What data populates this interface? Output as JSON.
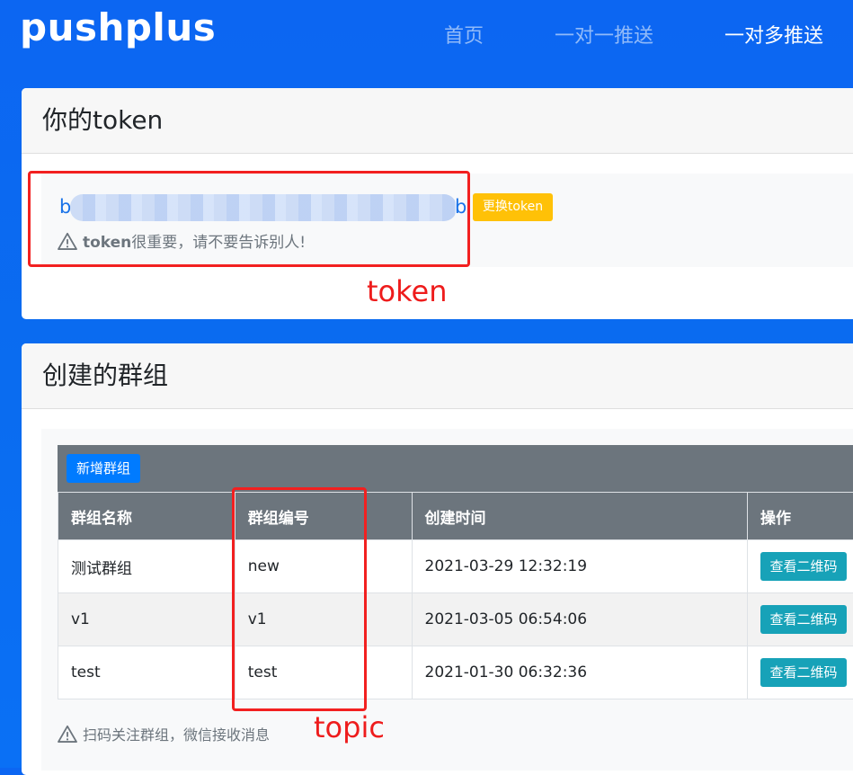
{
  "nav": {
    "brand": "pushplus",
    "links": [
      "首页",
      "一对一推送",
      "一对多推送"
    ]
  },
  "token_card": {
    "title": "你的token",
    "token_first_char": "b",
    "token_last_char": "b",
    "change_button": "更换token",
    "warning_bold": "token",
    "warning_text": "很重要，请不要告诉别人!"
  },
  "group_card": {
    "title": "创建的群组",
    "add_button": "新增群组",
    "columns": [
      "群组名称",
      "群组编号",
      "创建时间",
      "操作"
    ],
    "rows": [
      {
        "name": "测试群组",
        "code": "new",
        "created": "2021-03-29 12:32:19",
        "action": "查看二维码"
      },
      {
        "name": "v1",
        "code": "v1",
        "created": "2021-03-05 06:54:06",
        "action": "查看二维码"
      },
      {
        "name": "test",
        "code": "test",
        "created": "2021-01-30 06:32:36",
        "action": "查看二维码"
      }
    ],
    "footer_note": "扫码关注群组，微信接收消息"
  },
  "annotations": {
    "token_label": "token",
    "topic_label": "topic"
  },
  "colors": {
    "background": "#0a6cf0",
    "token_text": "#1a73e8",
    "change_button": "#ffc107",
    "add_button": "#007bff",
    "qr_button": "#17a2b8",
    "table_header": "#6c757d",
    "annotation": "#ee1c1c"
  }
}
